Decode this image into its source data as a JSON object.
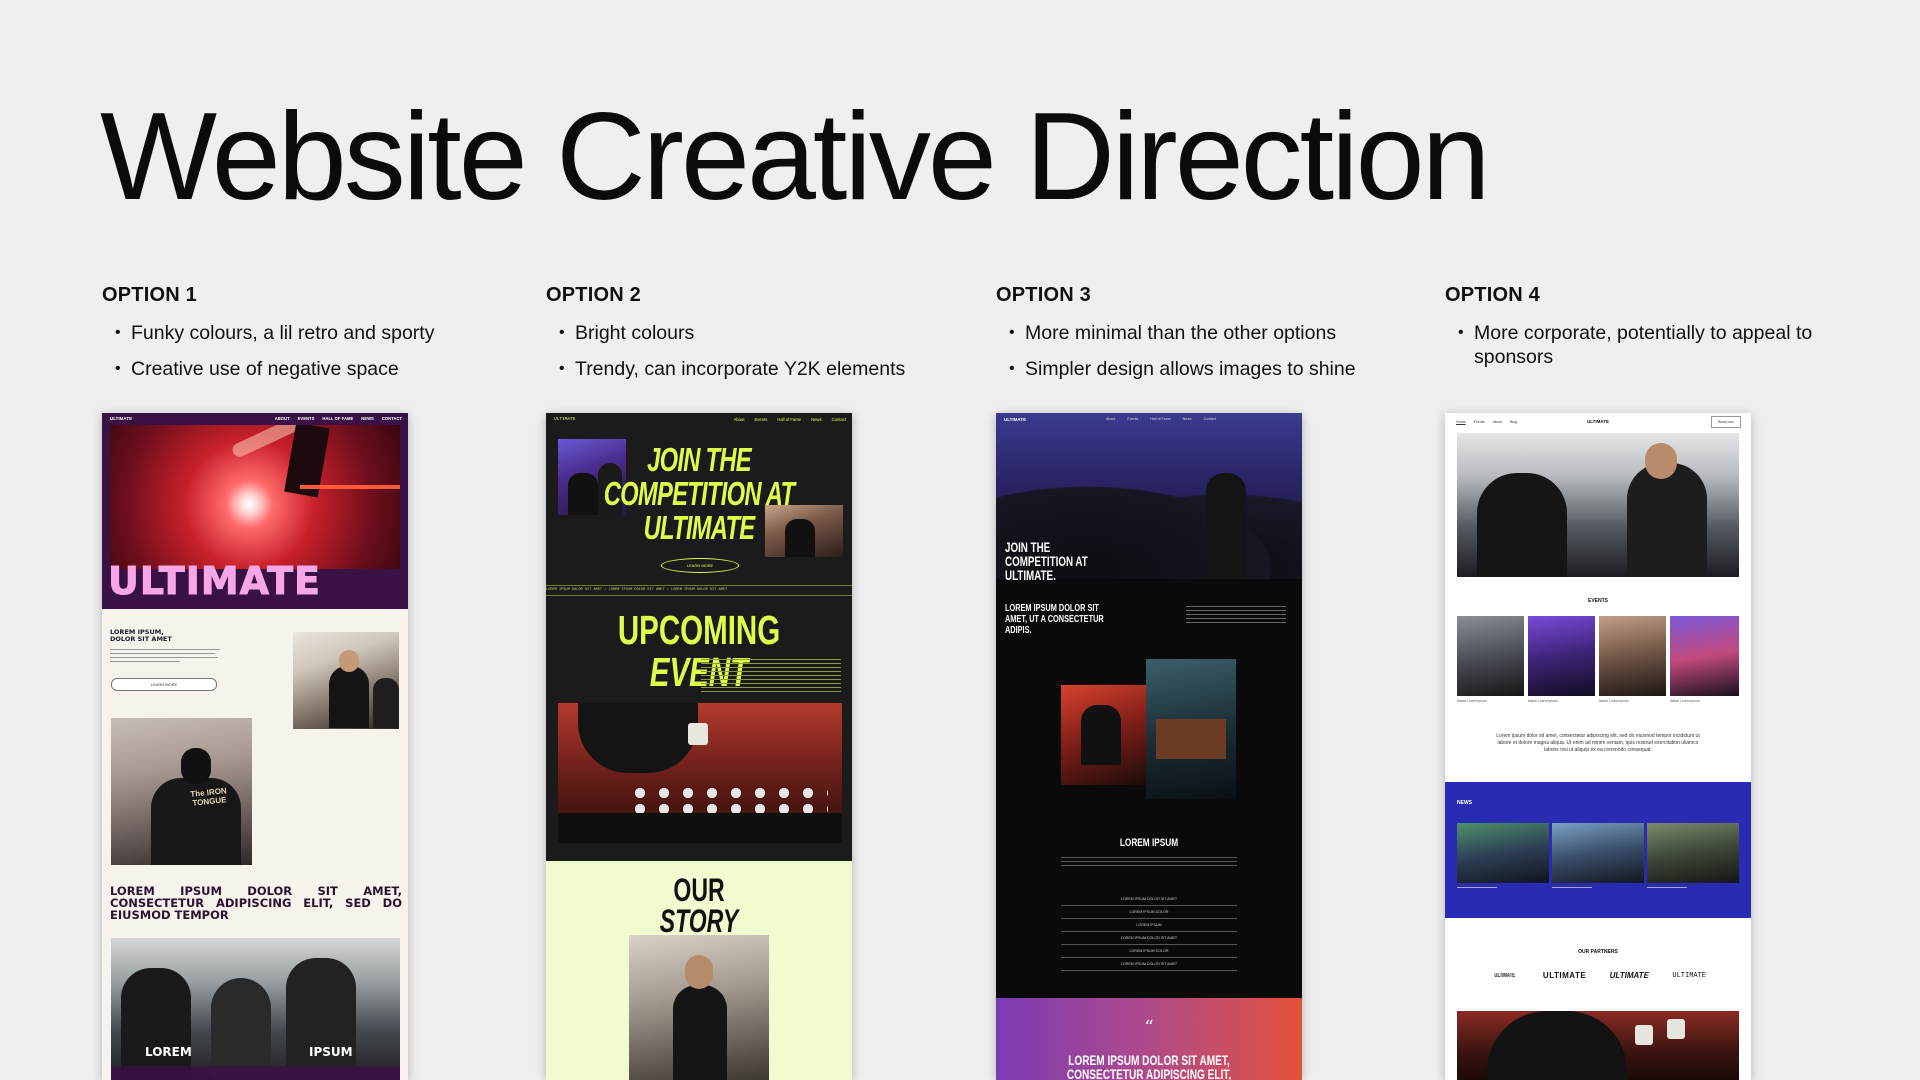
{
  "title": "Website Creative Direction",
  "options": [
    {
      "heading": "OPTION 1",
      "bullets": [
        "Funky colours, a lil retro and sporty",
        "Creative use of negative space"
      ],
      "mock": {
        "brand": "ULTIMATE",
        "nav": [
          "ABOUT",
          "EVENTS",
          "HALL OF FAME",
          "NEWS",
          "CONTACT"
        ],
        "hero": "ULTIMATE",
        "intro_heading": "LOREM IPSUM, DOLOR SIT AMET",
        "button": "LEARN MORE",
        "big_heading": "LOREM IPSUM DOLOR SIT AMET, CONSECTETUR ADIPISCING ELIT, SED DO EIUSMOD TEMPOR",
        "photo_left": "LOREM",
        "photo_right": "IPSUM",
        "shirt_text": "The IRON TONGUE"
      }
    },
    {
      "heading": "OPTION 2",
      "bullets": [
        "Bright colours",
        "Trendy, can incorporate Y2K elements"
      ],
      "mock": {
        "brand": "ULTIMATE",
        "nav": [
          "About",
          "Events",
          "Hall of Fame",
          "News",
          "Contact"
        ],
        "hero_l1": "JOIN THE",
        "hero_l2": "COMPETITION AT",
        "hero_l3": "ULTIMATE",
        "button": "LEARN MORE",
        "ticker": "LOREM IPSUM DOLOR SIT AMET  •  LOREM IPSUM DOLOR SIT AMET  •  LOREM IPSUM DOLOR SIT AMET",
        "upcoming_a": "UPCOMING",
        "upcoming_b": "EVENT",
        "story_a": "OUR",
        "story_b": "STORY"
      }
    },
    {
      "heading": "OPTION 3",
      "bullets": [
        "More minimal than the other options",
        "Simpler design allows images to shine"
      ],
      "mock": {
        "brand": "ULTIMATE",
        "nav": [
          "About",
          "Events",
          "Hall of Fame",
          "News",
          "Contact"
        ],
        "hero": "JOIN THE COMPETITION AT ULTIMATE.",
        "sub": "LOREM IPSUM DOLOR SIT AMET, UT A CONSECTETUR ADIPIS.",
        "section": "LOREM IPSUM",
        "list": [
          "LOREM IPSUM DOLOR SIT AMET",
          "LOREM IPSUM DOLOR",
          "LOREM IPSUM",
          "LOREM IPSUM DOLOR SIT AMET",
          "LOREM IPSUM DOLOR",
          "LOREM IPSUM DOLOR SIT AMET"
        ],
        "quote_mark": "“",
        "quote": "LOREM IPSUM DOLOR SIT AMET, CONSECTETUR ADIPISCING ELIT, SED DO"
      }
    },
    {
      "heading": "OPTION 4",
      "bullets": [
        "More corporate, potentially to appeal to sponsors"
      ],
      "mock": {
        "nav": [
          "Home",
          "Events",
          "About",
          "Blog"
        ],
        "brand": "ULTIMATE",
        "button": "Book now",
        "events_title": "EVENTS",
        "event_names": [
          "Name Lorem ipsum",
          "Name Lorem ipsum",
          "Name Lorem ipsum",
          "Name Lorem ipsum"
        ],
        "body": "Lorem ipsum dolor sit amet, consectetur adipiscing elit, sed do eiusmod tempor incididunt ut labore et dolore magna aliqua. Ut enim ad minim veniam, quis nostrud exercitation ullamco laboris nisi ut aliquip ex ea commodo consequat.",
        "news_title": "NEWS",
        "partners_title": "OUR PARTNERS",
        "partners": [
          "ULTIMATE",
          "ULTIMATE",
          "ULTIMATE",
          "ULTIMATE"
        ]
      }
    }
  ],
  "colors": {
    "bg": "#efefef",
    "o1_purple": "#3a1145",
    "o1_pink": "#f7a6e6",
    "o1_cream": "#f6f3ec",
    "o2_dark": "#1b1b1b",
    "o2_lime": "#e1fb4b",
    "o2_pale": "#f1fbd0",
    "o3_black": "#0a0a0a",
    "o4_blue": "#2a2bb3"
  }
}
